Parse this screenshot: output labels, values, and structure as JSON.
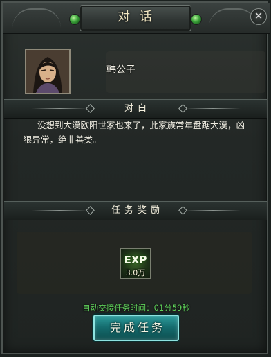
{
  "window": {
    "title": "对话",
    "close_icon": "close-icon"
  },
  "npc": {
    "name": "韩公子",
    "portrait_icon": "npc-portrait"
  },
  "dialogue": {
    "header": "对白",
    "text": "没想到大漠欧阳世家也来了，此家族常年盘踞大漠，凶狠异常，绝非善类。"
  },
  "reward": {
    "header": "任务奖励",
    "items": [
      {
        "label": "EXP",
        "amount": "3.0万",
        "icon": "exp-icon"
      }
    ]
  },
  "footer": {
    "timer_text": "自动交接任务时间：01分59秒",
    "complete_button": "完成任务"
  },
  "colors": {
    "accent_green": "#5fd15a",
    "button_teal": "#146a6c",
    "panel_dark": "#232826"
  }
}
